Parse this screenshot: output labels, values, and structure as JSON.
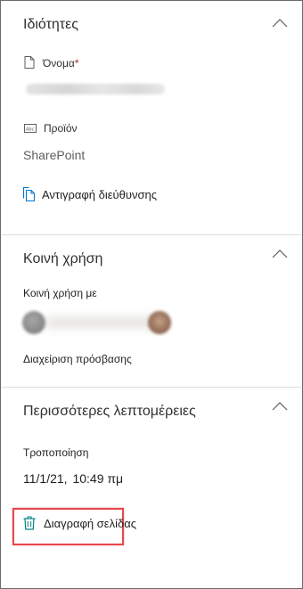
{
  "properties": {
    "title": "Ιδιότητες",
    "name_label": "Όνομα",
    "required_mark": "*",
    "product_label": "Προϊόν",
    "product_value": "SharePoint",
    "copy_address": "Αντιγραφή διεύθυνσης"
  },
  "sharing": {
    "title": "Κοινή χρήση",
    "shared_with_label": "Κοινή χρήση με",
    "manage_access": "Διαχείριση πρόσβασης"
  },
  "more_details": {
    "title": "Περισσότερες λεπτομέρειες",
    "modified_label": "Τροποποίηση",
    "modified_date": "11/1/21,",
    "modified_time": "10:49 πμ",
    "delete_page": "Διαγραφή σελίδας"
  },
  "icons": {
    "collapse": "chevron-up-icon",
    "name": "document-icon",
    "product": "text-field-icon",
    "copy": "copy-icon",
    "delete": "trash-icon"
  },
  "colors": {
    "link_icon": "#0078d4",
    "delete_icon": "#038387",
    "highlight": "#e8474b",
    "required": "#a4262c"
  }
}
